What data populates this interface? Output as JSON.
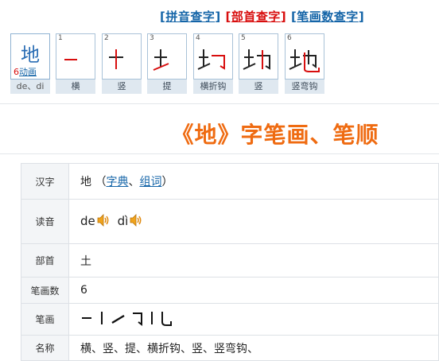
{
  "nav": {
    "links": [
      {
        "label": "拼音查字",
        "color": "#1565a8"
      },
      {
        "label": "部首查字",
        "color": "#d80e0e"
      },
      {
        "label": "笔画数查字",
        "color": "#1565a8"
      }
    ],
    "open_bracket": "[",
    "close_bracket": "]"
  },
  "character_card": {
    "char": "地",
    "stroke_count": "6",
    "animate_label": "动画",
    "pinyin": "de、di"
  },
  "strokes": [
    {
      "num": "1",
      "name": "横"
    },
    {
      "num": "2",
      "name": "竖"
    },
    {
      "num": "3",
      "name": "提"
    },
    {
      "num": "4",
      "name": "横折钩"
    },
    {
      "num": "5",
      "name": "竖"
    },
    {
      "num": "6",
      "name": "竖弯钩"
    }
  ],
  "page_title": "《地》字笔画、笔顺",
  "table": {
    "hanzi": {
      "label": "汉字",
      "char": "地",
      "open": " （",
      "dict_link": "字典",
      "sep": "、",
      "word_link": "组词",
      "close": "）"
    },
    "reading": {
      "label": "读音",
      "pinyin1": "de",
      "pinyin2": "dì"
    },
    "radical": {
      "label": "部首",
      "value": "土"
    },
    "count": {
      "label": "笔画数",
      "value": "6"
    },
    "strokes_row": {
      "label": "笔画"
    },
    "names": {
      "label": "名称",
      "value": "横、竖、提、横折钩、竖、竖弯钩、"
    }
  },
  "colors": {
    "accent_orange": "#ef6b11",
    "link_blue": "#1565a8",
    "stroke_red": "#d80e0e"
  }
}
